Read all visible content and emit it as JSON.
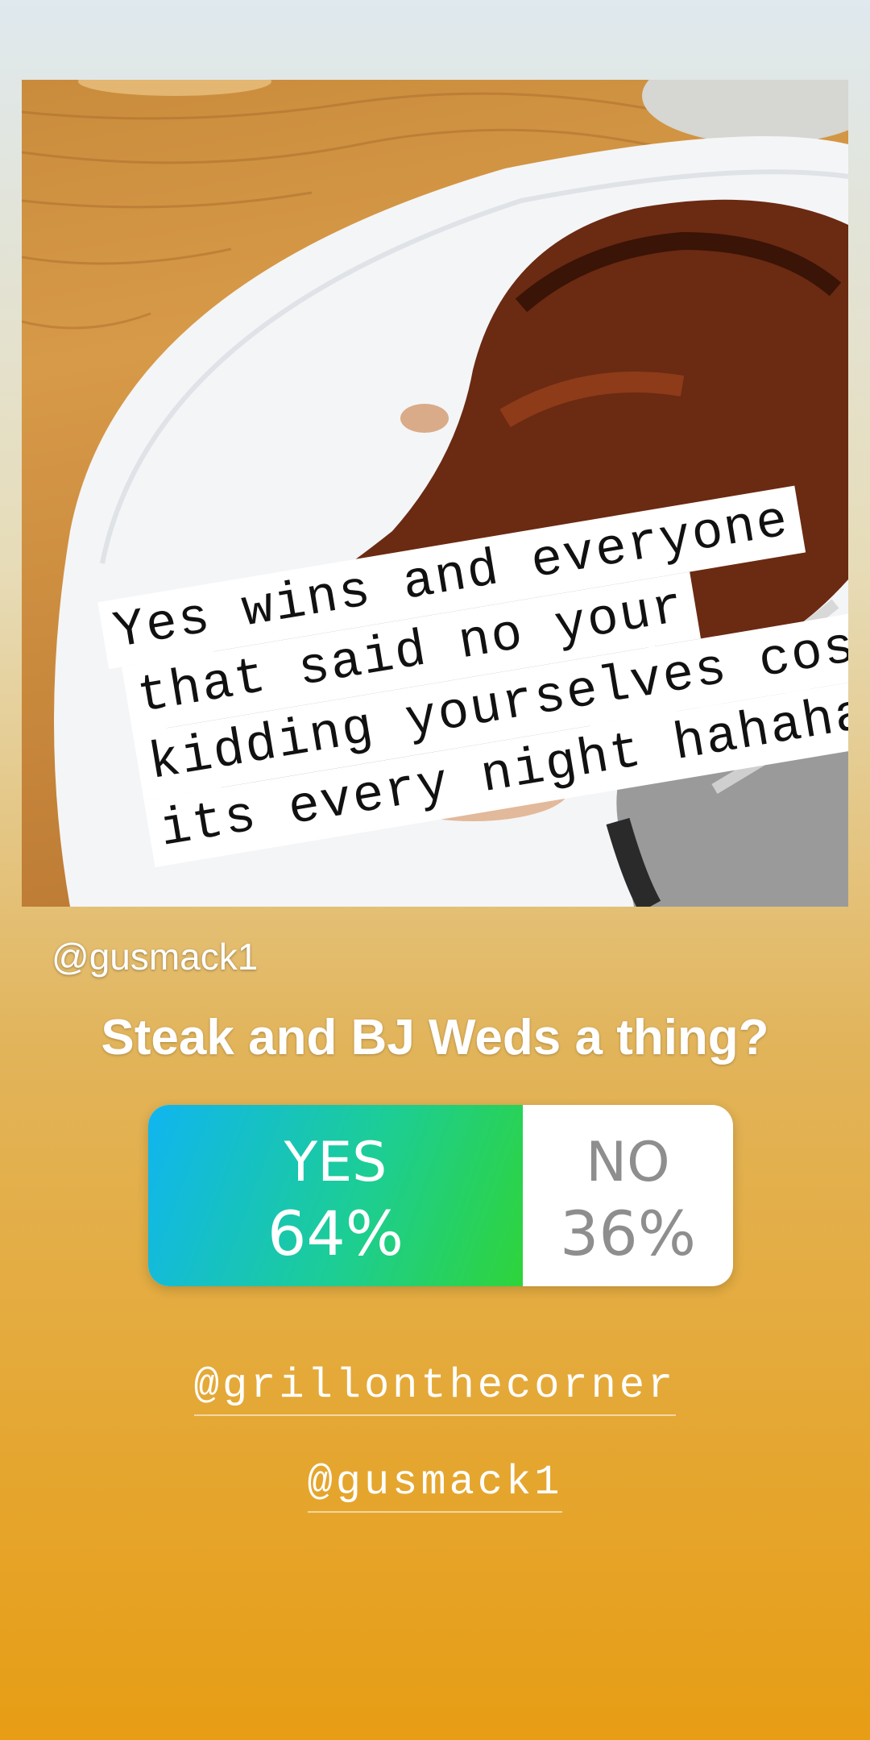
{
  "story": {
    "caption_lines": [
      "Yes wins and everyone",
      "that said no your",
      "kidding yourselves cos",
      "its every night hahaha"
    ],
    "username_top": "@gusmack1",
    "question": "Steak and BJ Weds a thing?",
    "poll": {
      "options": [
        {
          "label": "YES",
          "percent_text": "64%",
          "share": 0.64
        },
        {
          "label": "NO",
          "percent_text": "36%",
          "share": 0.36
        }
      ]
    },
    "mentions": [
      "@grillonthecorner",
      "@gusmack1"
    ]
  },
  "icons": {
    "fork": "fork-icon"
  }
}
